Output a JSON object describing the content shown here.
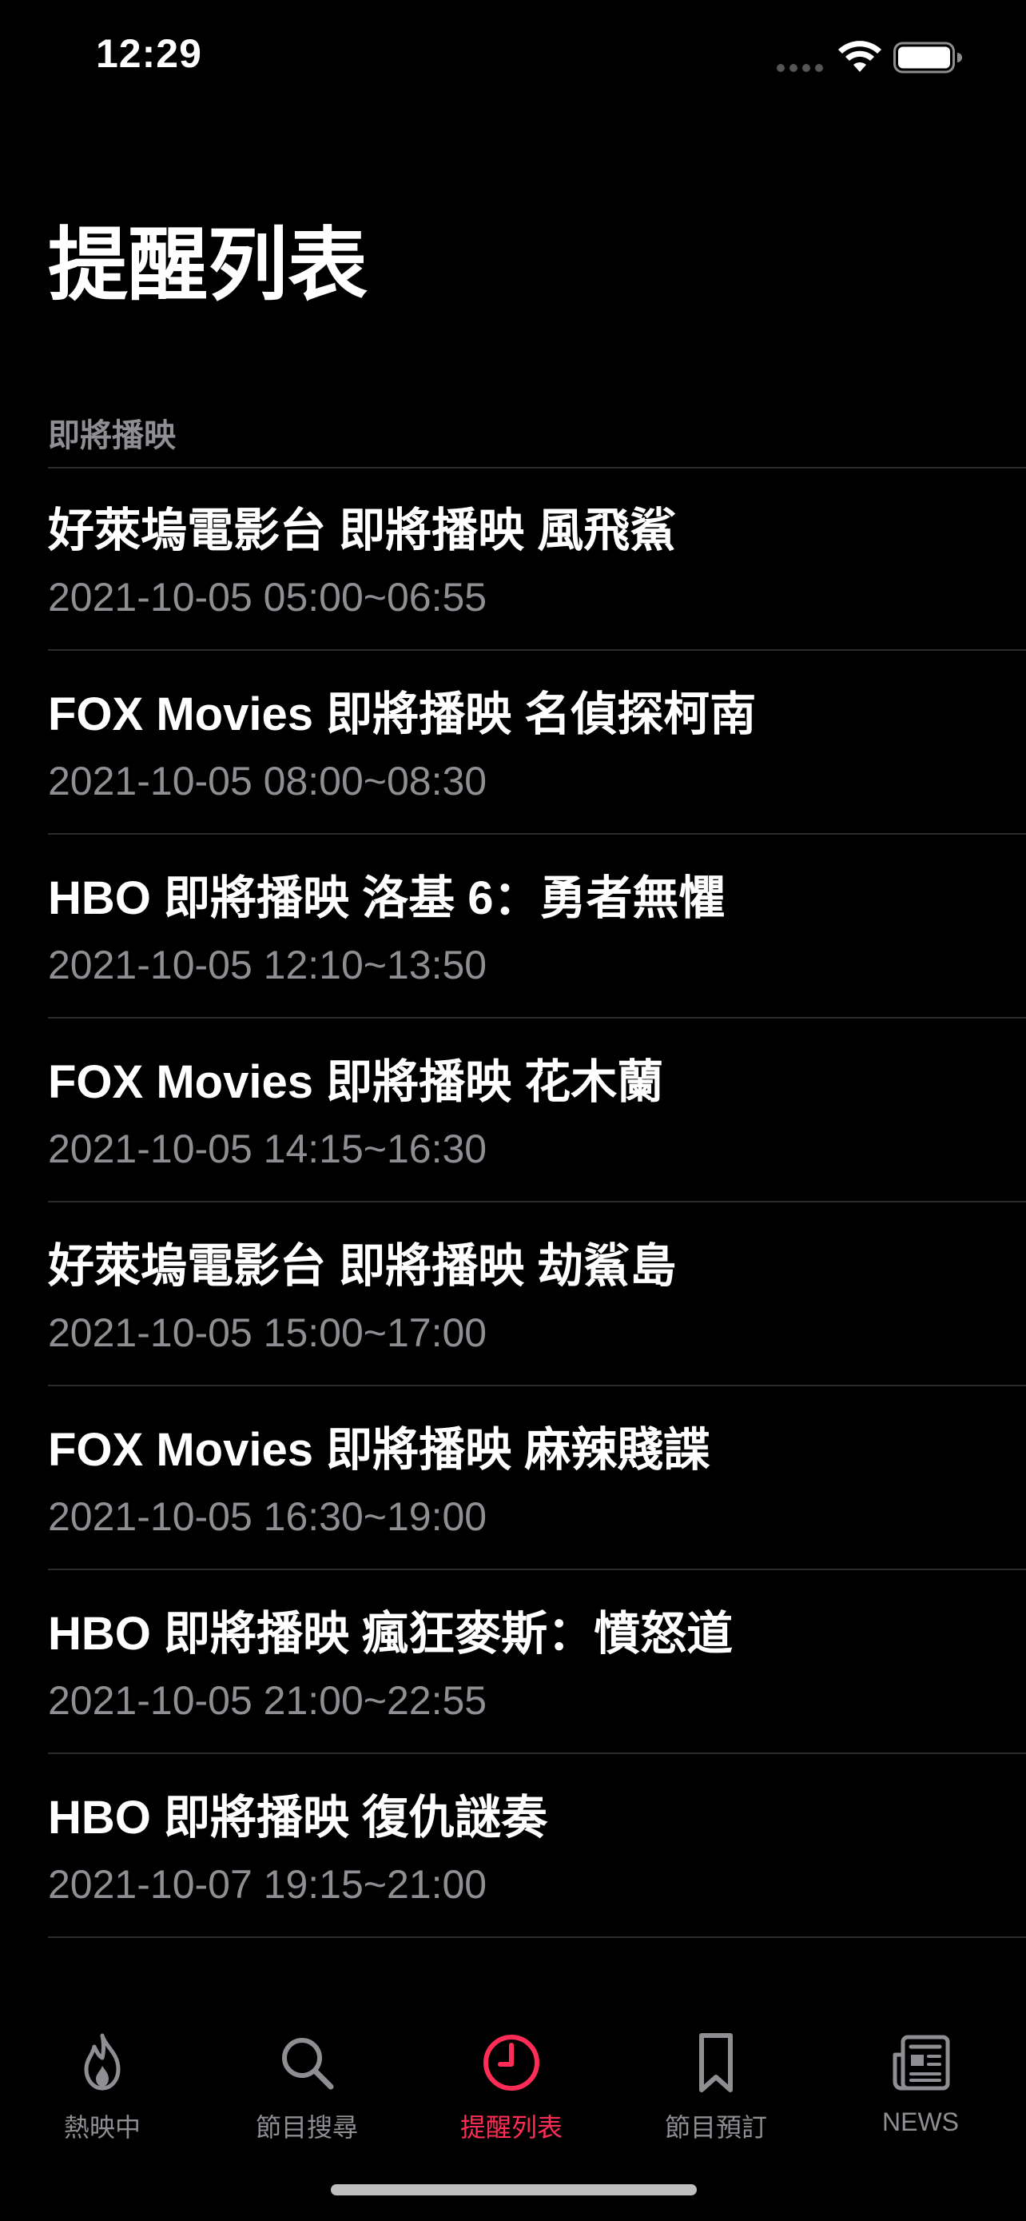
{
  "status_bar": {
    "time": "12:29"
  },
  "page_title": "提醒列表",
  "section_header": "即將播映",
  "reminders": [
    {
      "title": "好萊塢電影台 即將播映 風飛鯊",
      "time": "2021-10-05 05:00~06:55"
    },
    {
      "title": "FOX Movies 即將播映 名偵探柯南",
      "time": "2021-10-05 08:00~08:30"
    },
    {
      "title": "HBO 即將播映 洛基 6：勇者無懼",
      "time": "2021-10-05 12:10~13:50"
    },
    {
      "title": "FOX Movies 即將播映 花木蘭",
      "time": "2021-10-05 14:15~16:30"
    },
    {
      "title": "好萊塢電影台 即將播映 劫鯊島",
      "time": "2021-10-05 15:00~17:00"
    },
    {
      "title": "FOX Movies 即將播映 麻辣賤諜",
      "time": "2021-10-05 16:30~19:00"
    },
    {
      "title": "HBO 即將播映 瘋狂麥斯：憤怒道",
      "time": "2021-10-05 21:00~22:55"
    },
    {
      "title": "HBO 即將播映 復仇謎奏",
      "time": "2021-10-07 19:15~21:00"
    }
  ],
  "tabs": [
    {
      "label": "熱映中",
      "icon": "flame-icon",
      "active": false
    },
    {
      "label": "節目搜尋",
      "icon": "search-icon",
      "active": false
    },
    {
      "label": "提醒列表",
      "icon": "clock-icon",
      "active": true
    },
    {
      "label": "節目預訂",
      "icon": "bookmark-icon",
      "active": false
    },
    {
      "label": "NEWS",
      "icon": "newspaper-icon",
      "active": false
    }
  ],
  "colors": {
    "background": "#000000",
    "accent": "#ff2d55",
    "secondary_text": "#8e8e93",
    "separator": "#2c2c2e"
  }
}
